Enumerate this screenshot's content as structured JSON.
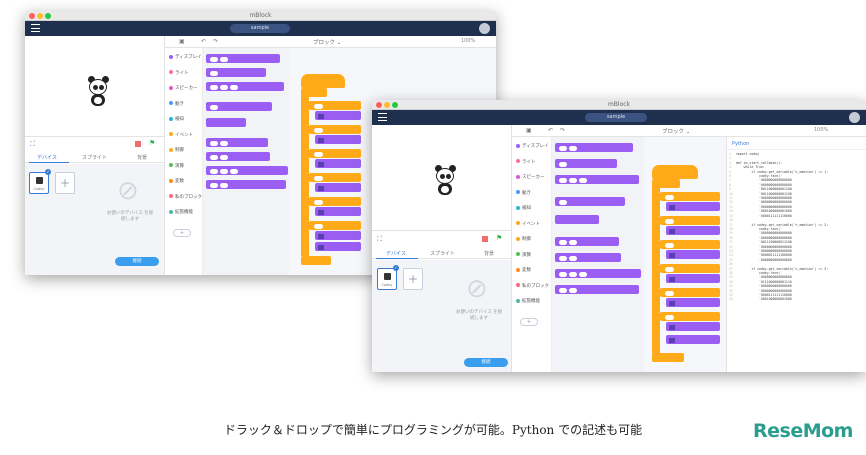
{
  "app": {
    "window_title": "mBlock",
    "project_name": "sample",
    "colors": {
      "navbar": "#1f2f4e",
      "accent": "#3a7bd5",
      "events": "#ffab19",
      "looks": "#9a5ff2"
    }
  },
  "toolbar": {
    "undo_icon": "undo-icon",
    "redo_icon": "redo-icon",
    "mode_label": "ブロック ⌄",
    "zoom": "100%"
  },
  "left_panel": {
    "tabs": [
      "デバイス",
      "スプライト",
      "背景"
    ],
    "device_name": "Codey",
    "device_badge": "✓",
    "add_label": "+",
    "no_device_text": "お使いのデバイス を接続します",
    "connect_label": "接続"
  },
  "categories": [
    "ディスプレイ",
    "ライト",
    "スピーカー",
    "動き",
    "検知",
    "イベント",
    "制御",
    "演算",
    "変数",
    "私のブロック",
    "拡張機能"
  ],
  "category_colors": [
    "#9a5ff2",
    "#ff6e9c",
    "#d65cd6",
    "#4c97ff",
    "#2cb3d6",
    "#ffab19",
    "#ffab19",
    "#59c059",
    "#ff8c1a",
    "#ff6680",
    "#4fb7a6"
  ],
  "categories_back_visible": [
    "ディスプレイ",
    "ライト",
    "スピーカー",
    "動き",
    "検知",
    "イベント",
    "制御",
    "演算",
    "変数",
    "私のブロック",
    "拡張機能"
  ],
  "python": {
    "title": "Python",
    "lines": [
      "import codey",
      "",
      "def on_start_callback():",
      "    while True:",
      "        if codey.get_variable('n_emotion') == 1:",
      "            codey.face('",
      "            '0000000000000000",
      "            '0000000000000000",
      "            '0011000000001100",
      "            '0011000000001100",
      "            '0000000000000000",
      "            '0000000000000000",
      "            '0000000000000000",
      "            '0001000000001000",
      "            '0000111111110000",
      "",
      "        if codey.get_variable('n_emotion') == 2:",
      "            codey.face('",
      "            '0000000000000000",
      "            '0000000000000000",
      "            '0011100000011100",
      "            '0000000000000000",
      "            '0000000000000000",
      "            '0000011111100000",
      "            '0000000000000000",
      "",
      "        if codey.get_variable('n_emotion') == 3:",
      "            codey.face('",
      "            '0000000000000000",
      "            '0111000000001110",
      "            '0000000000000000",
      "            '0000000000000000",
      "            '0000111111110000",
      "            '0001000000001000"
    ]
  },
  "caption": "ドラック＆ドロップで簡単にプログラミングが可能。Python での記述も可能",
  "watermark": "ReseMom"
}
